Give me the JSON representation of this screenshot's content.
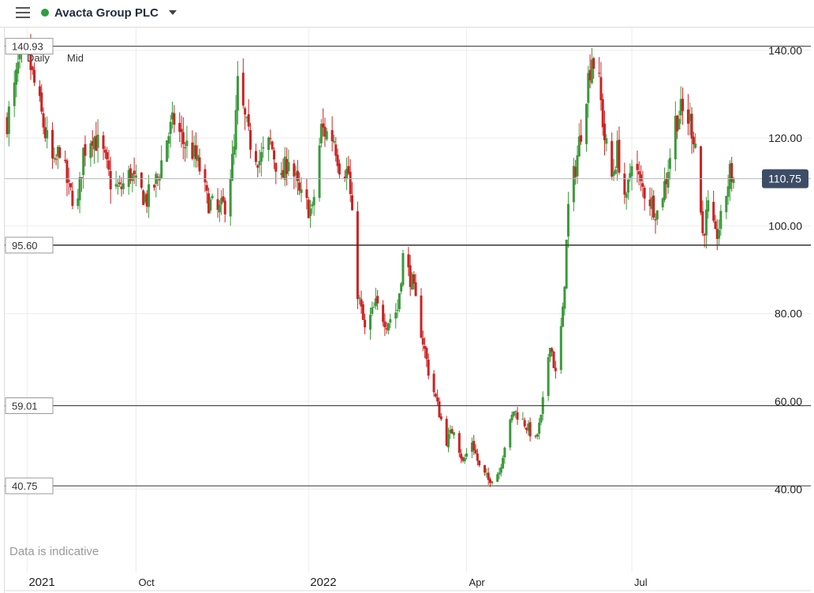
{
  "header": {
    "menu_icon": "hamburger-menu-icon",
    "instrument": "Avacta Group PLC",
    "status_color": "#2e9e3e",
    "dropdown_icon": "chevron-down-icon"
  },
  "toolbar": {
    "interval": "Daily",
    "price_type": "Mid"
  },
  "watermark": "Data is indicative",
  "chart_data": {
    "type": "candlestick",
    "ylim": [
      21,
      145
    ],
    "yticks": [
      {
        "value": 40,
        "label": "40.00"
      },
      {
        "value": 60,
        "label": "60.00"
      },
      {
        "value": 80,
        "label": "80.00"
      },
      {
        "value": 100,
        "label": "100.00"
      },
      {
        "value": 120,
        "label": "120.00"
      },
      {
        "value": 140,
        "label": "140.00"
      }
    ],
    "xticks": [
      {
        "date": "2021-08-02",
        "label": "2021"
      },
      {
        "date": "2021-10-01",
        "label": "Oct"
      },
      {
        "date": "2022-01-04",
        "label": "2022"
      },
      {
        "date": "2022-04-01",
        "label": "Apr"
      },
      {
        "date": "2022-07-01",
        "label": "Jul"
      }
    ],
    "xrange": [
      "2021-07-22",
      "2022-08-26"
    ],
    "current_price": {
      "value": 110.75,
      "label": "110.75",
      "color": "#3d4d66"
    },
    "horizontal_levels": [
      {
        "value": 140.93,
        "label": "140.93"
      },
      {
        "value": 95.6,
        "label": "95.60"
      },
      {
        "value": 59.01,
        "label": "59.01"
      },
      {
        "value": 40.75,
        "label": "40.75"
      }
    ],
    "up_color": "#3a9a3a",
    "down_color": "#cc2222",
    "anchor_closes": [
      [
        "2021-07-22",
        124
      ],
      [
        "2021-07-26",
        131
      ],
      [
        "2021-07-28",
        136
      ],
      [
        "2021-08-03",
        138
      ],
      [
        "2021-08-05",
        134
      ],
      [
        "2021-08-09",
        127
      ],
      [
        "2021-08-12",
        121
      ],
      [
        "2021-08-17",
        113
      ],
      [
        "2021-08-20",
        118
      ],
      [
        "2021-08-25",
        108
      ],
      [
        "2021-08-30",
        105
      ],
      [
        "2021-09-02",
        117
      ],
      [
        "2021-09-07",
        121
      ],
      [
        "2021-09-13",
        116
      ],
      [
        "2021-09-17",
        110
      ],
      [
        "2021-09-22",
        108
      ],
      [
        "2021-09-28",
        112
      ],
      [
        "2021-10-01",
        109
      ],
      [
        "2021-10-07",
        106
      ],
      [
        "2021-10-13",
        111
      ],
      [
        "2021-10-18",
        120
      ],
      [
        "2021-10-22",
        124
      ],
      [
        "2021-10-27",
        119
      ],
      [
        "2021-11-01",
        117
      ],
      [
        "2021-11-05",
        113
      ],
      [
        "2021-11-09",
        106
      ],
      [
        "2021-11-15",
        103
      ],
      [
        "2021-11-19",
        105
      ],
      [
        "2021-11-24",
        117
      ],
      [
        "2021-11-26",
        132
      ],
      [
        "2021-12-02",
        120
      ],
      [
        "2021-12-08",
        115
      ],
      [
        "2021-12-14",
        119
      ],
      [
        "2021-12-20",
        110
      ],
      [
        "2021-12-24",
        116
      ],
      [
        "2021-12-30",
        107
      ],
      [
        "2022-01-06",
        103
      ],
      [
        "2022-01-11",
        122
      ],
      [
        "2022-01-18",
        120
      ],
      [
        "2022-01-21",
        114
      ],
      [
        "2022-01-26",
        112
      ],
      [
        "2022-01-31",
        85
      ],
      [
        "2022-02-04",
        76
      ],
      [
        "2022-02-10",
        82
      ],
      [
        "2022-02-16",
        78
      ],
      [
        "2022-02-22",
        81
      ],
      [
        "2022-02-25",
        93
      ],
      [
        "2022-03-02",
        87
      ],
      [
        "2022-03-07",
        76
      ],
      [
        "2022-03-11",
        67
      ],
      [
        "2022-03-16",
        59
      ],
      [
        "2022-03-21",
        51
      ],
      [
        "2022-03-25",
        54
      ],
      [
        "2022-03-30",
        46
      ],
      [
        "2022-04-04",
        51
      ],
      [
        "2022-04-08",
        45
      ],
      [
        "2022-04-13",
        42
      ],
      [
        "2022-04-19",
        44
      ],
      [
        "2022-04-22",
        50
      ],
      [
        "2022-04-27",
        58
      ],
      [
        "2022-05-03",
        55
      ],
      [
        "2022-05-09",
        51
      ],
      [
        "2022-05-12",
        56
      ],
      [
        "2022-05-17",
        74
      ],
      [
        "2022-05-20",
        66
      ],
      [
        "2022-05-24",
        80
      ],
      [
        "2022-05-27",
        104
      ],
      [
        "2022-06-01",
        116
      ],
      [
        "2022-06-06",
        131
      ],
      [
        "2022-06-09",
        139
      ],
      [
        "2022-06-13",
        132
      ],
      [
        "2022-06-16",
        120
      ],
      [
        "2022-06-20",
        111
      ],
      [
        "2022-06-23",
        117
      ],
      [
        "2022-06-28",
        105
      ],
      [
        "2022-07-01",
        116
      ],
      [
        "2022-07-06",
        109
      ],
      [
        "2022-07-11",
        106
      ],
      [
        "2022-07-15",
        103
      ],
      [
        "2022-07-20",
        111
      ],
      [
        "2022-07-25",
        124
      ],
      [
        "2022-07-28",
        126
      ],
      [
        "2022-08-02",
        124
      ],
      [
        "2022-08-05",
        119
      ],
      [
        "2022-08-09",
        98
      ],
      [
        "2022-08-12",
        104
      ],
      [
        "2022-08-16",
        97
      ],
      [
        "2022-08-19",
        101
      ],
      [
        "2022-08-24",
        112
      ],
      [
        "2022-08-26",
        110.75
      ]
    ]
  }
}
